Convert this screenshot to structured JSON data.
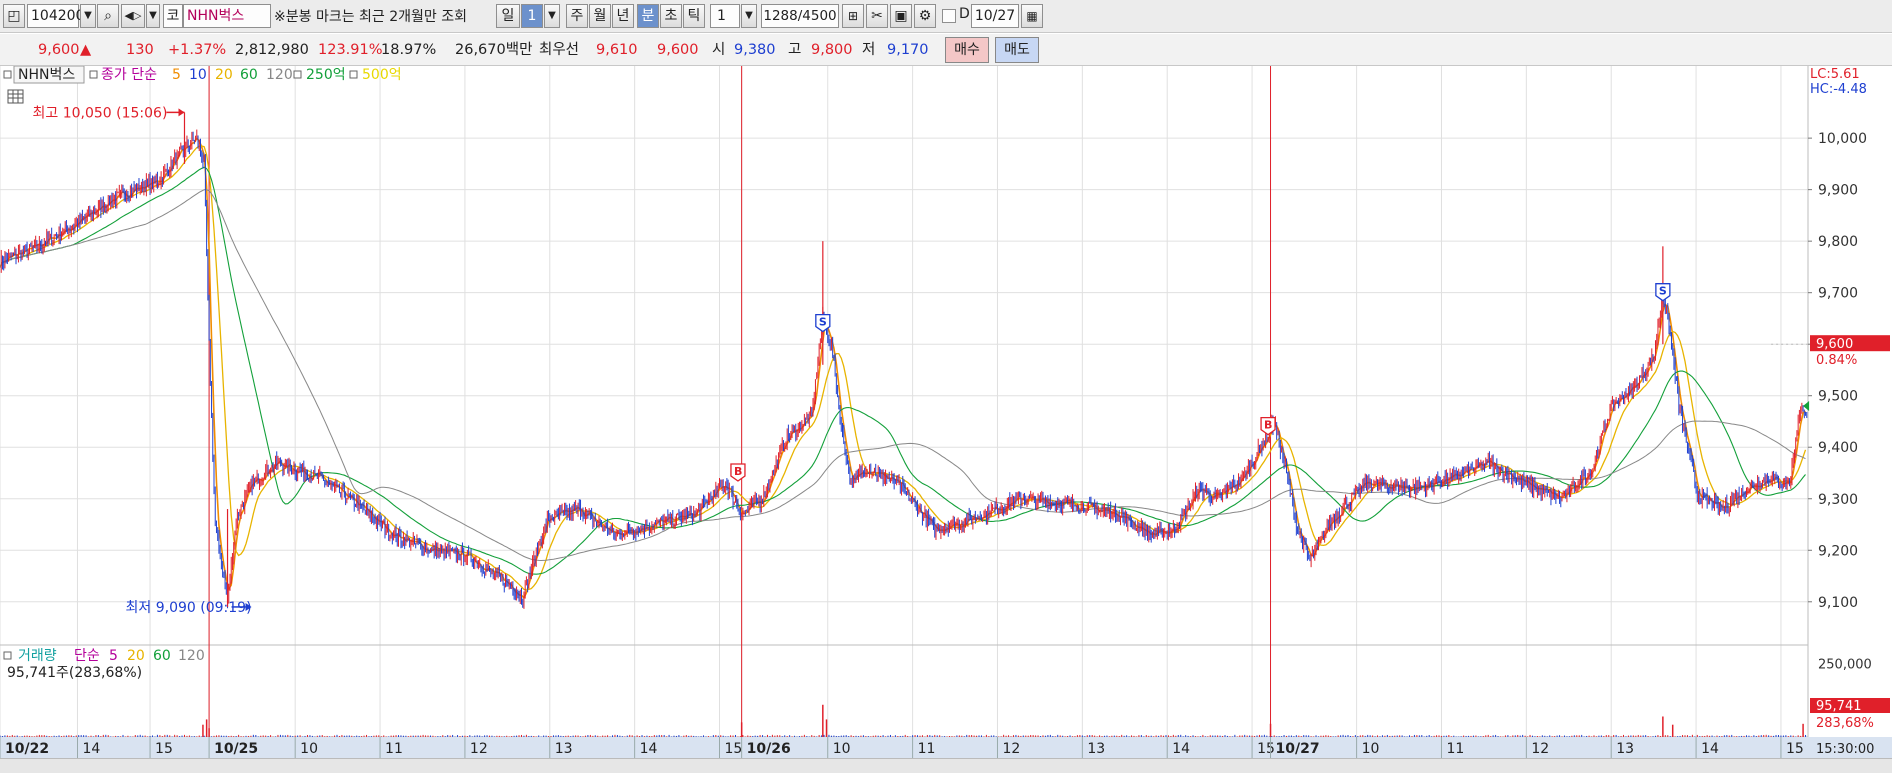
{
  "toolbar": {
    "code": "104200",
    "market_badge": "코",
    "stock_name": "NHN벅스",
    "notice": "※분봉 마크는 최근 2개월만 조회",
    "period_day": "일",
    "period_day_count": "1",
    "period_week": "주",
    "period_month": "월",
    "period_year": "년",
    "period_minute": "분",
    "period_second": "초",
    "period_tick": "틱",
    "interval_value": "1",
    "count_display": "1288",
    "count_total": "/4500",
    "date_checkbox_label": "D",
    "date_value": "10/27"
  },
  "quote": {
    "price": "9,600",
    "change_arrow": "▲",
    "change": "130",
    "change_pct": "+1.37%",
    "volume": "2,812,980",
    "volume_ratio": "123.91%",
    "turnover": "18.97%",
    "trade_value": "26,670백만",
    "best_label": "최우선",
    "best_ask": "9,610",
    "best_bid": "9,600",
    "open_label": "시",
    "open": "9,380",
    "high_label": "고",
    "high": "9,800",
    "low_label": "저",
    "low": "9,170",
    "buy_button": "매수",
    "sell_button": "매도"
  },
  "legend": {
    "price": {
      "name": "NHN벅스",
      "type": "종가 단순",
      "ma5": "5",
      "ma10": "10",
      "ma20": "20",
      "ma60": "60",
      "ma120": "120",
      "ma250": "250억",
      "ma500": "500억"
    },
    "volume": {
      "name": "거래량",
      "type": "단순",
      "ma5": "5",
      "ma20": "20",
      "ma60": "60",
      "ma120": "120",
      "current": "95,741주(283,68%)"
    }
  },
  "right_info": {
    "lc": "LC:5.61",
    "hc": "HC:-4.48"
  },
  "colors": {
    "up": "#e0202a",
    "down": "#1e3fd0",
    "ma5": "#f08c00",
    "ma10": "#1e3fd0",
    "ma20": "#e8b400",
    "ma60": "#13a03a",
    "ma120": "#888888",
    "grid": "#e0e0e0",
    "vline": "#e0202a"
  },
  "chart_data": {
    "type": "candlestick",
    "price_ylim": [
      9020,
      10140
    ],
    "y_ticks": [
      "10,000",
      "9,900",
      "9,800",
      "9,700",
      "9,600",
      "9,500",
      "9,400",
      "9,300",
      "9,200",
      "9,100"
    ],
    "y_tick_values": [
      10000,
      9900,
      9800,
      9700,
      9600,
      9500,
      9400,
      9300,
      9200,
      9100
    ],
    "x_ticks": [
      "10/22",
      "14",
      "15",
      "10/25",
      "10",
      "11",
      "12",
      "13",
      "14",
      "15",
      "10/26",
      "10",
      "11",
      "12",
      "13",
      "14",
      "15",
      "10/27",
      "10",
      "11",
      "12",
      "13",
      "14",
      "15"
    ],
    "x_tick_bold": [
      true,
      false,
      false,
      true,
      false,
      false,
      false,
      false,
      false,
      false,
      true,
      false,
      false,
      false,
      false,
      false,
      false,
      true,
      false,
      false,
      false,
      false,
      false,
      false
    ],
    "x_tick_index": [
      0,
      63,
      122,
      170,
      240,
      309,
      378,
      447,
      516,
      585,
      603,
      673,
      742,
      811,
      880,
      949,
      1018,
      1033,
      1103,
      1172,
      1241,
      1310,
      1379,
      1448
    ],
    "day_separator_index": [
      170,
      603,
      1033
    ],
    "total_bars": 1470,
    "price_path": [
      [
        0,
        9760
      ],
      [
        30,
        9790
      ],
      [
        60,
        9830
      ],
      [
        90,
        9880
      ],
      [
        110,
        9900
      ],
      [
        130,
        9920
      ],
      [
        150,
        9980
      ],
      [
        160,
        10000
      ],
      [
        166,
        9950
      ],
      [
        170,
        9600
      ],
      [
        175,
        9250
      ],
      [
        185,
        9100
      ],
      [
        192,
        9260
      ],
      [
        205,
        9330
      ],
      [
        225,
        9370
      ],
      [
        260,
        9340
      ],
      [
        290,
        9290
      ],
      [
        320,
        9230
      ],
      [
        350,
        9200
      ],
      [
        380,
        9190
      ],
      [
        410,
        9140
      ],
      [
        425,
        9110
      ],
      [
        430,
        9150
      ],
      [
        445,
        9260
      ],
      [
        470,
        9280
      ],
      [
        500,
        9230
      ],
      [
        530,
        9250
      ],
      [
        565,
        9270
      ],
      [
        590,
        9330
      ],
      [
        603,
        9270
      ],
      [
        620,
        9300
      ],
      [
        640,
        9420
      ],
      [
        660,
        9460
      ],
      [
        669,
        9650
      ],
      [
        676,
        9600
      ],
      [
        684,
        9440
      ],
      [
        692,
        9330
      ],
      [
        705,
        9360
      ],
      [
        730,
        9330
      ],
      [
        760,
        9240
      ],
      [
        790,
        9260
      ],
      [
        830,
        9300
      ],
      [
        870,
        9290
      ],
      [
        910,
        9270
      ],
      [
        935,
        9230
      ],
      [
        955,
        9240
      ],
      [
        975,
        9320
      ],
      [
        990,
        9300
      ],
      [
        1010,
        9340
      ],
      [
        1030,
        9420
      ],
      [
        1036,
        9450
      ],
      [
        1045,
        9360
      ],
      [
        1055,
        9240
      ],
      [
        1065,
        9180
      ],
      [
        1080,
        9250
      ],
      [
        1110,
        9330
      ],
      [
        1150,
        9320
      ],
      [
        1180,
        9340
      ],
      [
        1210,
        9370
      ],
      [
        1240,
        9330
      ],
      [
        1270,
        9300
      ],
      [
        1295,
        9360
      ],
      [
        1310,
        9480
      ],
      [
        1330,
        9520
      ],
      [
        1345,
        9580
      ],
      [
        1352,
        9700
      ],
      [
        1358,
        9620
      ],
      [
        1365,
        9480
      ],
      [
        1380,
        9310
      ],
      [
        1400,
        9280
      ],
      [
        1420,
        9320
      ],
      [
        1440,
        9340
      ],
      [
        1455,
        9330
      ],
      [
        1462,
        9450
      ],
      [
        1466,
        9480
      ],
      [
        1470,
        9460
      ]
    ],
    "annotations": [
      {
        "label": "최고 10,050 (15:06)",
        "index": 150,
        "value": 10050
      },
      {
        "label": "최저 9,090 (09:19)",
        "index": 185,
        "value": 9090
      }
    ],
    "signals": [
      {
        "mark": "B",
        "index": 600,
        "value": 9350
      },
      {
        "mark": "S",
        "index": 669,
        "value": 9640
      },
      {
        "mark": "B",
        "index": 1031,
        "value": 9440
      },
      {
        "mark": "S",
        "index": 1352,
        "value": 9700
      }
    ],
    "current_price_tag": "9,600",
    "current_pct_tag": "0.84%",
    "current_price_value": 9600,
    "volume_ylim": [
      0,
      290000
    ],
    "volume_tick": "250,000",
    "volume_tick_value": 250000,
    "volume_spikes": [
      [
        165,
        42000
      ],
      [
        168,
        60000
      ],
      [
        170,
        30000
      ],
      [
        603,
        50000
      ],
      [
        669,
        110000
      ],
      [
        672,
        60000
      ],
      [
        1033,
        45000
      ],
      [
        1352,
        70000
      ],
      [
        1360,
        42000
      ],
      [
        1466,
        45000
      ]
    ],
    "current_volume_tag": "95,741",
    "current_volume_pct_tag": "283,68%",
    "time_label": "15:30:00"
  }
}
